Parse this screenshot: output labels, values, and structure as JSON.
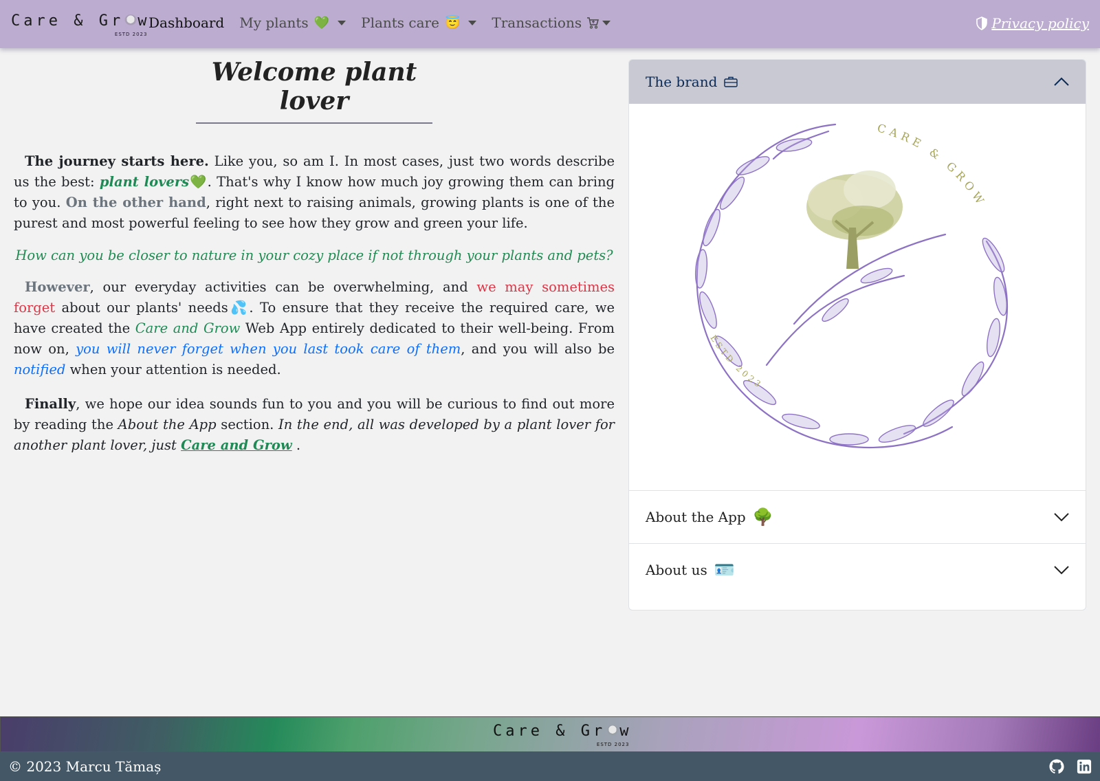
{
  "navbar": {
    "brand_text_a": "Care & Gr",
    "brand_text_b": "w",
    "brand_estd": "ESTD 2023",
    "links": [
      {
        "label": "Dashboard",
        "emoji": ""
      },
      {
        "label": "My plants",
        "emoji": "💚"
      },
      {
        "label": "Plants care",
        "emoji": "😇"
      },
      {
        "label": "Transactions",
        "emoji": ""
      }
    ],
    "privacy": "Privacy policy"
  },
  "main": {
    "title": "Welcome plant lover",
    "p1": {
      "lead": "The journey starts here.",
      "t1": " Like you, so am I. In most cases, just two words describe us the best: ",
      "plant_lovers": "plant lovers",
      "heart": "💚",
      "t2": ". That's why I know how much joy growing them can bring to you. ",
      "on_other": "On the other hand",
      "t3": ", right next to raising animals, growing plants is one of the purest and most powerful feeling to see how they grow and green your life."
    },
    "quote": "How can you be closer to nature in your cozy place if not through your plants and pets?",
    "p2": {
      "however": "However",
      "t1": ", our everyday activities can be overwhelming, and ",
      "forget": "we may sometimes forget",
      "t2": " about our plants' needs",
      "drops": "💦",
      "t3": ". To ensure that they receive the required care, we have created the ",
      "app": "Care and Grow",
      "t4": " Web App entirely dedicated to their well-being. From now on, ",
      "never": "you will never forget when you last took care of them",
      "t5": ", and you will also be ",
      "notified": "notified",
      "t6": " when your attention is needed."
    },
    "p3": {
      "finally": "Finally",
      "t1": ", we hope our idea sounds fun to you and you will be curious to find out more by reading the ",
      "about": "About the App",
      "t2": " section. ",
      "end": "In the end, all was developed by a plant lover for another plant lover, just ",
      "link": "Care and Grow",
      "t3": " ."
    }
  },
  "accordion": {
    "brand_label": "The brand",
    "logo_text_top": "CARE & GROW",
    "logo_text_bottom": "ESTD 2023",
    "about_app": "About the App",
    "about_app_emoji": "🌳",
    "about_us": "About us",
    "about_us_emoji": "🪪"
  },
  "footer": {
    "brand_a": "Care & Gr",
    "brand_b": "w",
    "estd": "ESTD 2023",
    "copyright": "© 2023 Marcu Tămaș"
  },
  "colors": {
    "navbar": "#bcadd0",
    "accent_green": "#1f8a55",
    "accent_blue": "#0d6efd",
    "accent_red": "#dc3545",
    "footer": "#435766"
  }
}
